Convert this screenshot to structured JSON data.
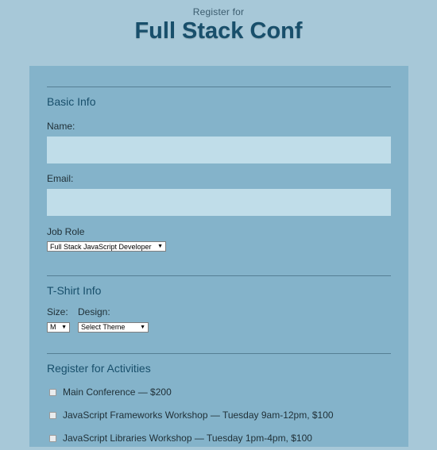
{
  "header": {
    "pre_title": "Register for",
    "title": "Full Stack Conf"
  },
  "basic_info": {
    "legend": "Basic Info",
    "name_label": "Name:",
    "name_value": "",
    "email_label": "Email:",
    "email_value": "",
    "job_role_label": "Job Role",
    "job_role_selected": "Full Stack JavaScript Developer"
  },
  "tshirt": {
    "legend": "T-Shirt Info",
    "size_label": "Size:",
    "size_selected": "M",
    "design_label": "Design:",
    "design_selected": "Select Theme"
  },
  "activities": {
    "legend": "Register for Activities",
    "items": [
      {
        "label": "Main Conference — $200",
        "checked": false
      },
      {
        "label": "JavaScript Frameworks Workshop — Tuesday 9am-12pm, $100",
        "checked": false
      },
      {
        "label": "JavaScript Libraries Workshop — Tuesday 1pm-4pm, $100",
        "checked": false
      }
    ]
  },
  "colors": {
    "page_bg": "#a7c8d8",
    "form_bg": "#84b3ca",
    "input_bg": "#c0dde9",
    "title": "#184f6b"
  }
}
